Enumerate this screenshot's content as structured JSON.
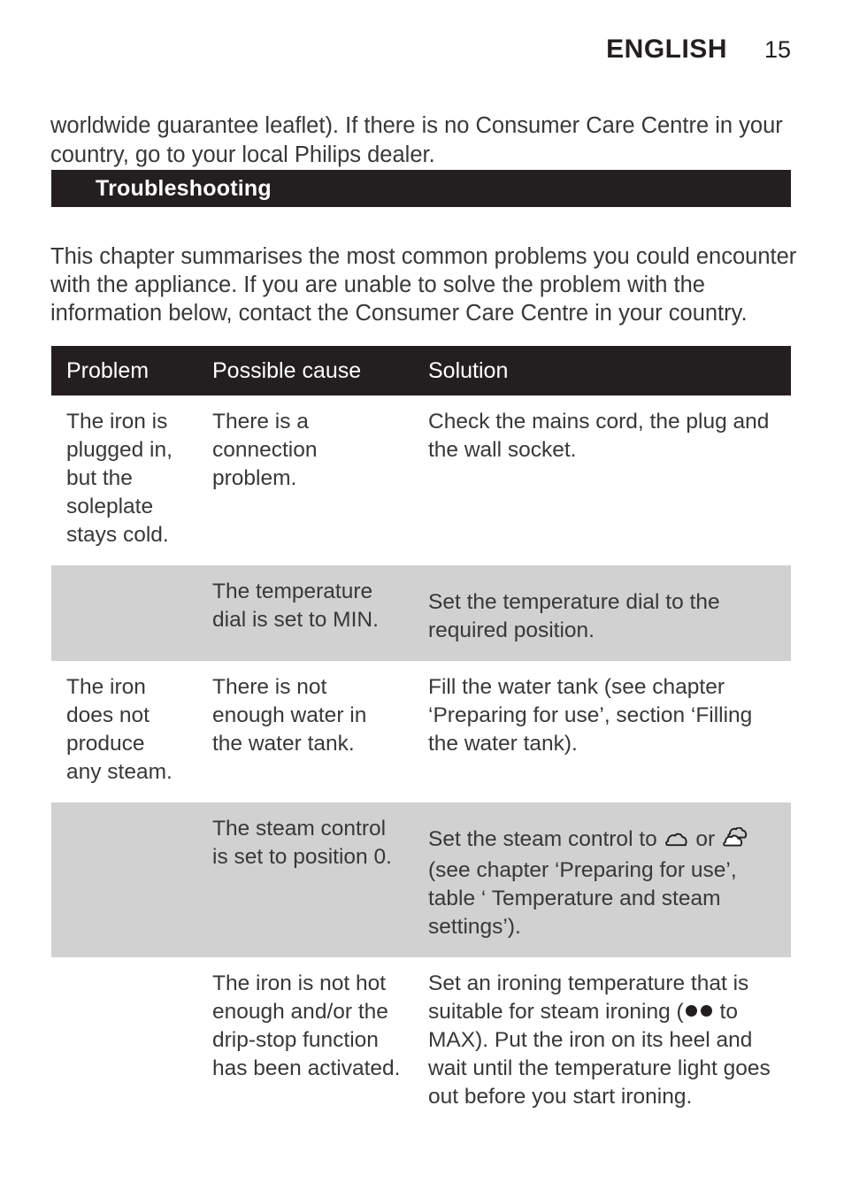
{
  "header": {
    "language": "ENGLISH",
    "page_number": "15"
  },
  "intro_paragraph_1": "worldwide guarantee leaflet). If there is no Consumer Care Centre in your country, go to your local Philips dealer.",
  "section": {
    "title": "Troubleshooting",
    "description": "This chapter summarises the most common problems you could encounter with the appliance. If you are unable to solve the problem with the information below, contact the Consumer Care Centre in your country."
  },
  "table": {
    "headers": {
      "problem": "Problem",
      "cause": "Possible cause",
      "solution": "Solution"
    },
    "rows": [
      {
        "shaded": false,
        "problem": "The iron is plugged in, but the soleplate stays cold.",
        "cause": "There is a connection problem.",
        "solution": "Check the mains cord, the plug and the wall socket."
      },
      {
        "shaded": true,
        "problem": "",
        "cause": "The temperature dial is set to MIN.",
        "solution": "Set the temperature dial to the required position."
      },
      {
        "shaded": false,
        "problem": "The iron does not produce any steam.",
        "cause": "There is not enough water in the water tank.",
        "solution": "Fill the water tank (see chapter ‘Preparing for use’, section ‘Filling the water tank)."
      },
      {
        "shaded": true,
        "problem": "",
        "cause": "The steam control is set to position 0.",
        "solution_part_1": "Set the steam control to",
        "solution_icon_1": "steam-single-icon",
        "solution_conjunction": "or",
        "solution_icon_2": "steam-double-icon",
        "solution_part_2": "(see chapter ‘Preparing for use’, table ‘ Temperature and steam settings’)."
      },
      {
        "shaded": false,
        "problem": "",
        "cause": "The iron is not hot enough and/or the drip-stop function has been activated.",
        "solution_part_1": "Set an ironing temperature that is suitable for steam ironing (",
        "solution_dots": "two-dots-icon",
        "solution_part_2": "to MAX). Put the iron on its heel and wait until the temperature light goes out before you start ironing."
      }
    ]
  },
  "colors": {
    "ink": "#231f20",
    "body_text": "#3a3738",
    "banner_background": "#231f20",
    "shaded_row": "#d1d1d1",
    "page_background": "#ffffff"
  }
}
